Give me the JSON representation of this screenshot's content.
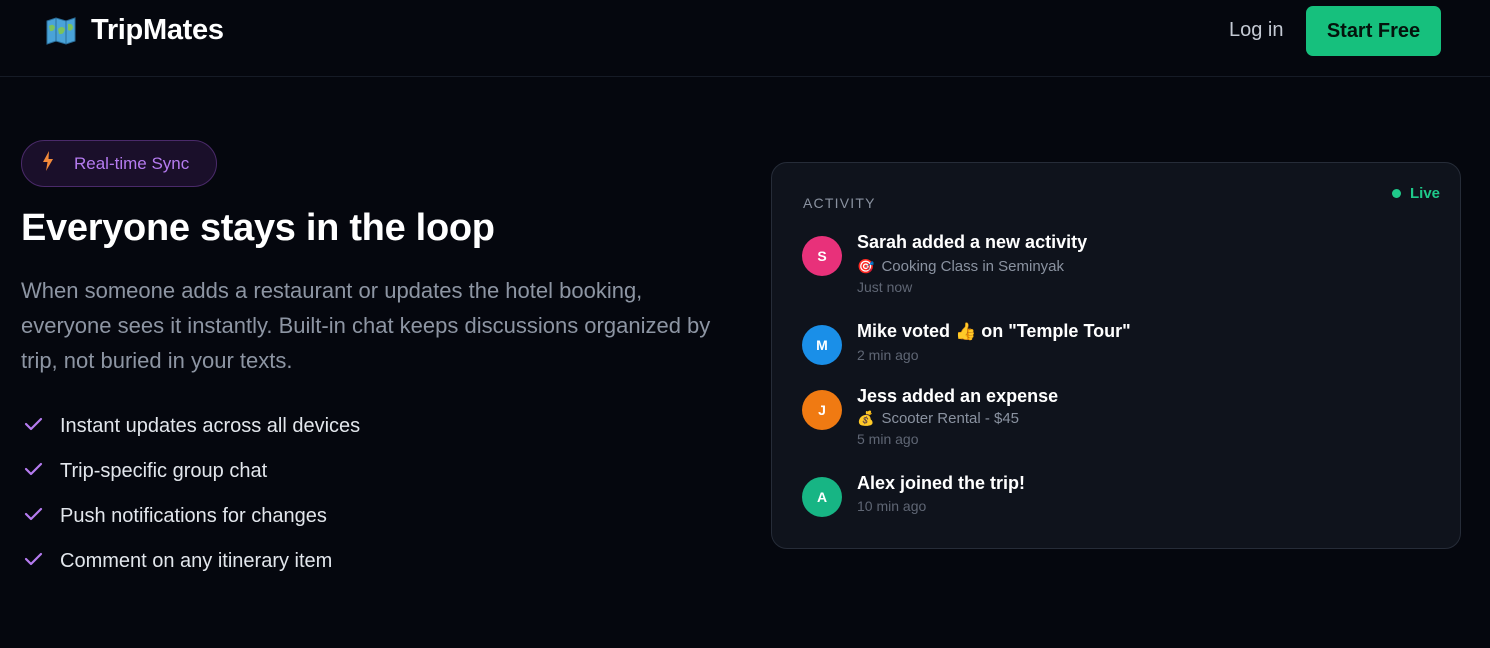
{
  "nav": {
    "brand": "TripMates",
    "brand_icon": "map-icon",
    "login_label": "Log in",
    "cta_label": "Start Free"
  },
  "hero": {
    "badge_icon": "lightning-icon",
    "badge_label": "Real-time Sync",
    "title": "Everyone stays in the loop",
    "description": "When someone adds a restaurant or updates the hotel booking, everyone sees it instantly. Built-in chat keeps discussions organized by trip, not buried in your texts.",
    "features": [
      "Instant updates across all devices",
      "Trip-specific group chat",
      "Push notifications for changes",
      "Comment on any itinerary item"
    ]
  },
  "activity": {
    "title": "ACTIVITY",
    "live_label": "Live",
    "items": [
      {
        "initial": "S",
        "color": "#e8317a",
        "title": "Sarah added a new activity",
        "detail_icon": "🎯",
        "detail": "Cooking Class in Seminyak",
        "time": "Just now"
      },
      {
        "initial": "M",
        "color": "#1a8fe8",
        "title_pre": "Mike voted",
        "title_icon": "👍",
        "title_post": "on \"Temple Tour\"",
        "time": "2 min ago"
      },
      {
        "initial": "J",
        "color": "#f07a12",
        "title": "Jess added an expense",
        "detail_icon": "💰",
        "detail": "Scooter Rental - $45",
        "time": "5 min ago"
      },
      {
        "initial": "A",
        "color": "#17b584",
        "title": "Alex joined the trip!",
        "time": "10 min ago"
      }
    ]
  },
  "colors": {
    "accent_green": "#16c07d",
    "accent_purple": "#b57bf0",
    "background": "#05070e"
  }
}
